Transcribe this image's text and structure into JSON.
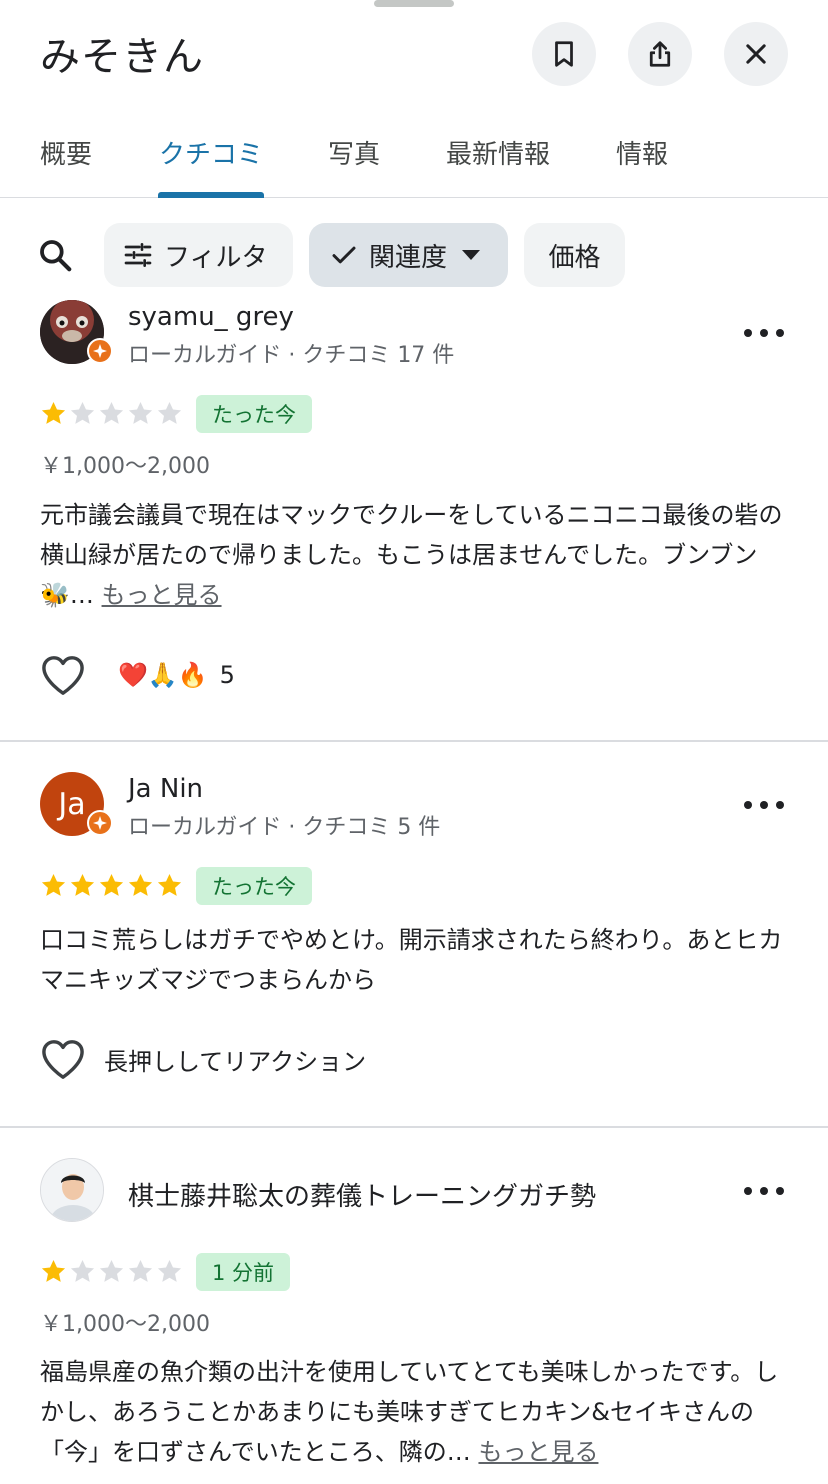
{
  "header": {
    "title": "みそきん"
  },
  "tabs": [
    {
      "label": "概要"
    },
    {
      "label": "クチコミ"
    },
    {
      "label": "写真"
    },
    {
      "label": "最新情報"
    },
    {
      "label": "情報"
    }
  ],
  "filters": {
    "filter_label": "フィルタ",
    "sort_label": "関連度",
    "price_label": "価格"
  },
  "colors": {
    "accent": "#1a73a8",
    "star_filled": "#fbbc04",
    "star_empty": "#dadce0",
    "badge_orange": "#e8711a",
    "time_badge_bg": "#cdf2d8",
    "time_badge_fg": "#137333"
  },
  "reviews": [
    {
      "name": "syamu_ grey",
      "meta": "ローカルガイド · クチコミ 17 件",
      "rating": 1,
      "time": "たった今",
      "price": "￥1,000～2,000",
      "text": "元市議会議員で現在はマックでクルーをしているニコニコ最後の砦の横山緑が居たので帰りました。もこうは居ませんでした。ブンブン🐝…",
      "more_label": "もっと見る",
      "reactions": "❤️🙏🔥",
      "reaction_count": "5"
    },
    {
      "name": "Ja Nin",
      "avatar_initials": "Ja",
      "meta": "ローカルガイド · クチコミ 5 件",
      "rating": 5,
      "time": "たった今",
      "text": "口コミ荒らしはガチでやめとけ。開示請求されたら終わり。あとヒカマニキッズマジでつまらんから",
      "reaction_prompt": "長押ししてリアクション"
    },
    {
      "name": "棋士藤井聡太の葬儀トレーニングガチ勢",
      "rating": 1,
      "time": "1 分前",
      "price": "￥1,000～2,000",
      "text": "福島県産の魚介類の出汁を使用していてとても美味しかったです。しかし、あろうことかあまりにも美味すぎてヒカキン&セイキさんの「今」を口ずさんでいたところ、隣の…",
      "more_label": "もっと見る"
    }
  ]
}
